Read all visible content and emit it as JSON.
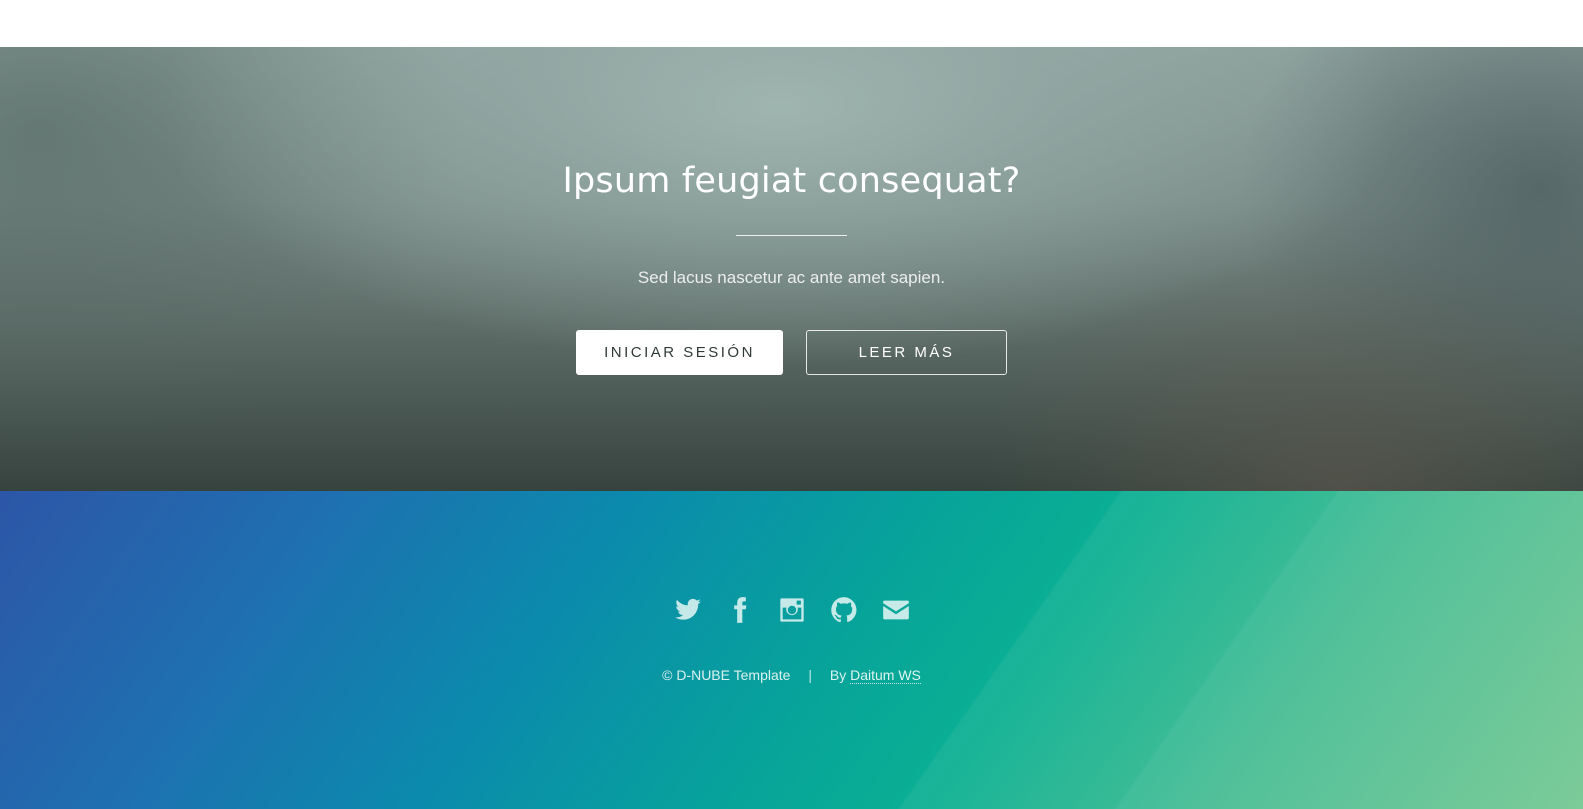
{
  "cta": {
    "title": "Ipsum feugiat consequat?",
    "subtitle": "Sed lacus nascetur ac ante amet sapien.",
    "primary_button": "INICIAR SESIÓN",
    "secondary_button": "LEER MÁS"
  },
  "footer": {
    "social_icons": [
      "twitter-icon",
      "facebook-icon",
      "instagram-icon",
      "github-icon",
      "envelope-icon"
    ],
    "copyright": "© D-NUBE Template",
    "separator": "|",
    "by_prefix": "By",
    "author_link": "Daitum WS"
  },
  "colors": {
    "cta_top": "#8da09c",
    "cta_bottom": "#36433e",
    "footer_left": "#2d56a8",
    "footer_mid": "#07a39b",
    "footer_right": "#6ac48a",
    "icon_color": "#d6f0ee"
  }
}
